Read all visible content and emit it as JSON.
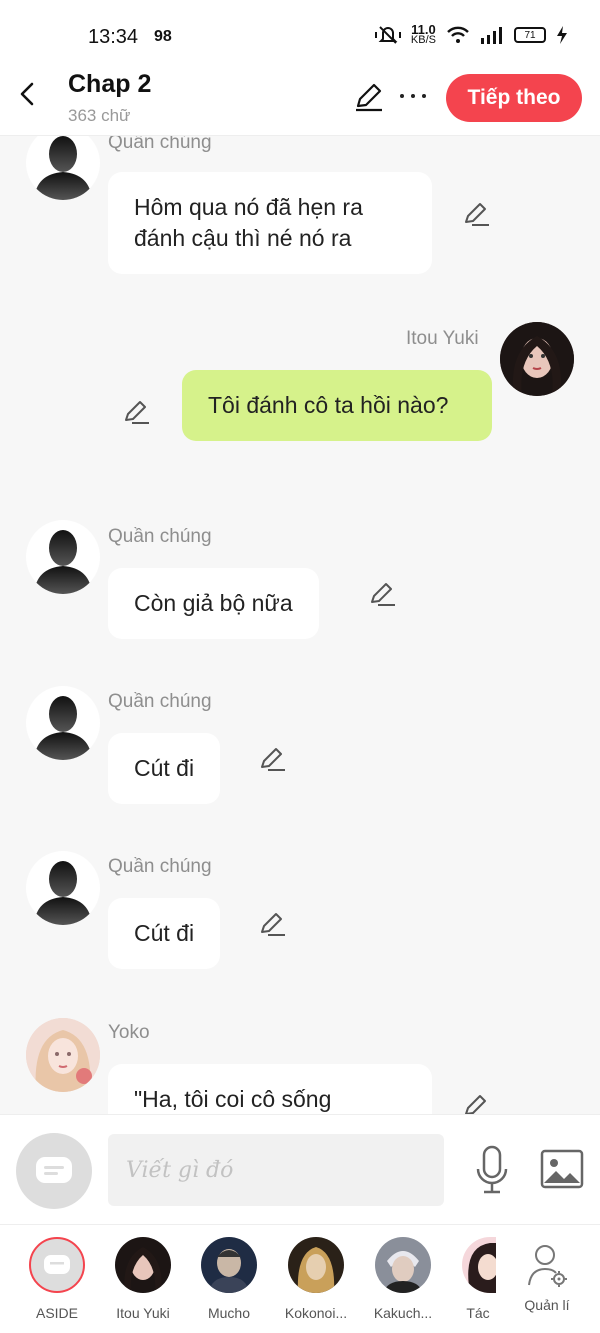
{
  "status_bar": {
    "time": "13:34",
    "indicator": "98",
    "net_speed_value": "11.0",
    "net_speed_unit": "KB/S",
    "battery": "71"
  },
  "header": {
    "title": "Chap 2",
    "word_count": "363 chữ",
    "next_button": "Tiếp theo"
  },
  "messages": [
    {
      "sender": "Quần chúng",
      "text": "Hôm qua nó đã hẹn ra đánh cậu thì né nó ra",
      "side": "left"
    },
    {
      "sender": "Itou Yuki",
      "text": "Tôi đánh cô ta hồi nào?",
      "side": "right"
    },
    {
      "sender": "Quần chúng",
      "text": "Còn giả bộ nữa",
      "side": "left"
    },
    {
      "sender": "Quần chúng",
      "text": "Cút đi",
      "side": "left"
    },
    {
      "sender": "Quần chúng",
      "text": "Cút đi",
      "side": "left"
    },
    {
      "sender": "Yoko",
      "text": "\"Ha, tôi coi cô sống",
      "side": "left"
    }
  ],
  "composer": {
    "placeholder": "Viết gì đó"
  },
  "characters": [
    {
      "label": "ASIDE"
    },
    {
      "label": "Itou Yuki"
    },
    {
      "label": "Mucho"
    },
    {
      "label": "Kokonoi..."
    },
    {
      "label": "Kakuch..."
    },
    {
      "label": "Tác"
    },
    {
      "label": "Quản lí"
    }
  ],
  "colors": {
    "accent": "#f4444e",
    "my_bubble": "#d6f28b",
    "background": "#f7f7f7"
  }
}
